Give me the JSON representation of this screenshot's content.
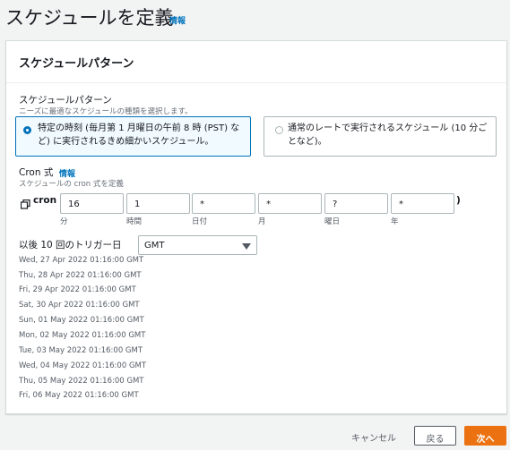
{
  "page": {
    "title": "スケジュールを定義",
    "info_link": "情報"
  },
  "card": {
    "title": "スケジュールパターン"
  },
  "pattern": {
    "label": "スケジュールパターン",
    "description": "ニーズに最適なスケジュールの種類を選択します。",
    "options": [
      {
        "line1": "特定の時刻 (毎月第 1 月曜日の午前 8 時 (PST) な",
        "line2": "ど) に実行されるきめ細かいスケジュール。",
        "selected": true
      },
      {
        "line1": "通常のレートで実行されるスケジュール (10 分ご",
        "line2": "となど)。",
        "selected": false
      }
    ]
  },
  "cron": {
    "label": "Cron 式",
    "info_link": "情報",
    "description": "スケジュールの cron 式を定義",
    "prefix": "cron (",
    "suffix": ")",
    "copy_icon": "copy-icon",
    "fields": [
      {
        "value": "16",
        "caption": "分"
      },
      {
        "value": "1",
        "caption": "時間"
      },
      {
        "value": "*",
        "caption": "日付"
      },
      {
        "value": "*",
        "caption": "月"
      },
      {
        "value": "?",
        "caption": "曜日"
      },
      {
        "value": "*",
        "caption": "年"
      }
    ]
  },
  "triggers": {
    "label": "以後 10 回のトリガー日",
    "timezone": "GMT",
    "dates": [
      "Wed, 27 Apr 2022 01:16:00 GMT",
      "Thu, 28 Apr 2022 01:16:00 GMT",
      "Fri, 29 Apr 2022 01:16:00 GMT",
      "Sat, 30 Apr 2022 01:16:00 GMT",
      "Sun, 01 May 2022 01:16:00 GMT",
      "Mon, 02 May 2022 01:16:00 GMT",
      "Tue, 03 May 2022 01:16:00 GMT",
      "Wed, 04 May 2022 01:16:00 GMT",
      "Thu, 05 May 2022 01:16:00 GMT",
      "Fri, 06 May 2022 01:16:00 GMT"
    ]
  },
  "footer": {
    "cancel": "キャンセル",
    "back": "戻る",
    "next": "次へ"
  },
  "colors": {
    "accent": "#0073bb",
    "primary_button": "#ec7211"
  }
}
